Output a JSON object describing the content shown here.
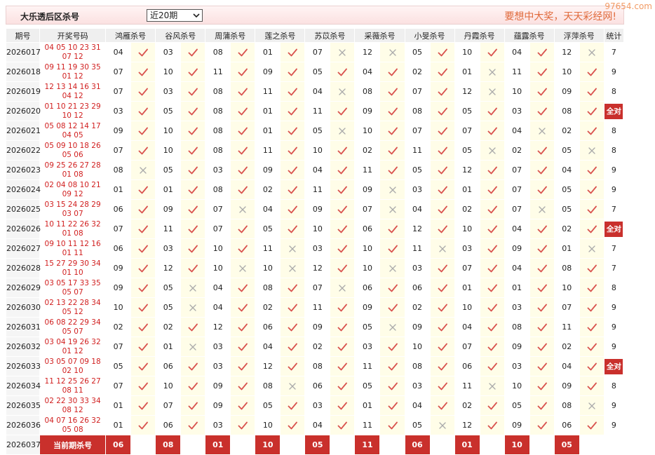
{
  "header": {
    "title": "大乐透后区杀号",
    "range_selected": "近20期",
    "slogan": "要想中大奖，天天彩经网!",
    "watermark": "97654.com"
  },
  "columns": [
    "期号",
    "开奖号码",
    "鸿雁杀号",
    "谷风杀号",
    "周蒲杀号",
    "莲之杀号",
    "苏苡杀号",
    "采薇杀号",
    "小旻杀号",
    "丹霞杀号",
    "蕴露杀号",
    "浮萍杀号",
    "统计"
  ],
  "rows": [
    {
      "period": "2026017",
      "front": "04 05 10 23 31",
      "back": "07 12",
      "kills": [
        [
          "04",
          1
        ],
        [
          "03",
          1
        ],
        [
          "08",
          1
        ],
        [
          "01",
          1
        ],
        [
          "07",
          0
        ],
        [
          "12",
          0
        ],
        [
          "05",
          1
        ],
        [
          "10",
          1
        ],
        [
          "04",
          1
        ],
        [
          "12",
          0
        ]
      ],
      "stat": "7"
    },
    {
      "period": "2026018",
      "front": "09 11 19 30 35",
      "back": "01 12",
      "kills": [
        [
          "07",
          1
        ],
        [
          "10",
          1
        ],
        [
          "11",
          1
        ],
        [
          "09",
          1
        ],
        [
          "05",
          1
        ],
        [
          "04",
          1
        ],
        [
          "02",
          1
        ],
        [
          "01",
          0
        ],
        [
          "11",
          1
        ],
        [
          "10",
          1
        ]
      ],
      "stat": "9"
    },
    {
      "period": "2026019",
      "front": "12 13 14 16 31",
      "back": "04 12",
      "kills": [
        [
          "07",
          1
        ],
        [
          "03",
          1
        ],
        [
          "08",
          1
        ],
        [
          "11",
          1
        ],
        [
          "04",
          0
        ],
        [
          "08",
          1
        ],
        [
          "07",
          1
        ],
        [
          "12",
          0
        ],
        [
          "10",
          1
        ],
        [
          "09",
          1
        ]
      ],
      "stat": "8"
    },
    {
      "period": "2026020",
      "front": "01 10 21 23 29",
      "back": "10 12",
      "kills": [
        [
          "03",
          1
        ],
        [
          "05",
          1
        ],
        [
          "08",
          1
        ],
        [
          "01",
          1
        ],
        [
          "11",
          1
        ],
        [
          "09",
          1
        ],
        [
          "08",
          1
        ],
        [
          "05",
          1
        ],
        [
          "03",
          1
        ],
        [
          "08",
          1
        ]
      ],
      "stat": "全对"
    },
    {
      "period": "2026021",
      "front": "05 08 12 14 17",
      "back": "04 05",
      "kills": [
        [
          "09",
          1
        ],
        [
          "10",
          1
        ],
        [
          "08",
          1
        ],
        [
          "01",
          1
        ],
        [
          "05",
          0
        ],
        [
          "10",
          1
        ],
        [
          "07",
          1
        ],
        [
          "07",
          1
        ],
        [
          "04",
          0
        ],
        [
          "02",
          1
        ]
      ],
      "stat": "8"
    },
    {
      "period": "2026022",
      "front": "05 09 10 18 26",
      "back": "05 06",
      "kills": [
        [
          "07",
          1
        ],
        [
          "10",
          1
        ],
        [
          "08",
          1
        ],
        [
          "11",
          1
        ],
        [
          "10",
          1
        ],
        [
          "02",
          1
        ],
        [
          "11",
          1
        ],
        [
          "05",
          0
        ],
        [
          "02",
          1
        ],
        [
          "05",
          0
        ]
      ],
      "stat": "8"
    },
    {
      "period": "2026023",
      "front": "09 25 26 27 28",
      "back": "01 08",
      "kills": [
        [
          "08",
          0
        ],
        [
          "05",
          1
        ],
        [
          "03",
          1
        ],
        [
          "09",
          1
        ],
        [
          "04",
          1
        ],
        [
          "11",
          1
        ],
        [
          "05",
          1
        ],
        [
          "12",
          1
        ],
        [
          "07",
          1
        ],
        [
          "04",
          1
        ]
      ],
      "stat": "9"
    },
    {
      "period": "2026024",
      "front": "02 04 08 10 21",
      "back": "09 12",
      "kills": [
        [
          "01",
          1
        ],
        [
          "01",
          1
        ],
        [
          "08",
          1
        ],
        [
          "02",
          1
        ],
        [
          "11",
          1
        ],
        [
          "09",
          0
        ],
        [
          "03",
          1
        ],
        [
          "01",
          1
        ],
        [
          "07",
          1
        ],
        [
          "05",
          1
        ]
      ],
      "stat": "9"
    },
    {
      "period": "2026025",
      "front": "03 15 24 28 29",
      "back": "03 07",
      "kills": [
        [
          "06",
          1
        ],
        [
          "09",
          1
        ],
        [
          "07",
          0
        ],
        [
          "04",
          1
        ],
        [
          "09",
          1
        ],
        [
          "07",
          0
        ],
        [
          "04",
          1
        ],
        [
          "02",
          1
        ],
        [
          "07",
          0
        ],
        [
          "05",
          1
        ]
      ],
      "stat": "7"
    },
    {
      "period": "2026026",
      "front": "10 11 22 26 32",
      "back": "01 08",
      "kills": [
        [
          "07",
          1
        ],
        [
          "11",
          1
        ],
        [
          "07",
          1
        ],
        [
          "05",
          1
        ],
        [
          "10",
          1
        ],
        [
          "06",
          1
        ],
        [
          "12",
          1
        ],
        [
          "10",
          1
        ],
        [
          "04",
          1
        ],
        [
          "02",
          1
        ]
      ],
      "stat": "全对"
    },
    {
      "period": "2026027",
      "front": "09 10 11 12 16",
      "back": "01 11",
      "kills": [
        [
          "06",
          1
        ],
        [
          "03",
          1
        ],
        [
          "10",
          1
        ],
        [
          "11",
          0
        ],
        [
          "03",
          1
        ],
        [
          "10",
          1
        ],
        [
          "11",
          0
        ],
        [
          "03",
          1
        ],
        [
          "09",
          1
        ],
        [
          "01",
          0
        ]
      ],
      "stat": "7"
    },
    {
      "period": "2026028",
      "front": "15 27 29 30 34",
      "back": "01 10",
      "kills": [
        [
          "09",
          1
        ],
        [
          "12",
          1
        ],
        [
          "10",
          0
        ],
        [
          "10",
          0
        ],
        [
          "12",
          1
        ],
        [
          "10",
          0
        ],
        [
          "03",
          1
        ],
        [
          "07",
          1
        ],
        [
          "04",
          1
        ],
        [
          "08",
          1
        ]
      ],
      "stat": "7"
    },
    {
      "period": "2026029",
      "front": "03 05 17 33 35",
      "back": "05 07",
      "kills": [
        [
          "09",
          1
        ],
        [
          "05",
          0
        ],
        [
          "04",
          1
        ],
        [
          "08",
          1
        ],
        [
          "07",
          0
        ],
        [
          "06",
          1
        ],
        [
          "06",
          1
        ],
        [
          "01",
          1
        ],
        [
          "01",
          1
        ],
        [
          "10",
          1
        ]
      ],
      "stat": "8"
    },
    {
      "period": "2026030",
      "front": "02 13 22 28 34",
      "back": "05 12",
      "kills": [
        [
          "10",
          1
        ],
        [
          "05",
          0
        ],
        [
          "04",
          1
        ],
        [
          "02",
          1
        ],
        [
          "11",
          1
        ],
        [
          "09",
          1
        ],
        [
          "02",
          1
        ],
        [
          "10",
          1
        ],
        [
          "03",
          1
        ],
        [
          "07",
          1
        ]
      ],
      "stat": "9"
    },
    {
      "period": "2026031",
      "front": "06 08 22 29 34",
      "back": "05 07",
      "kills": [
        [
          "02",
          1
        ],
        [
          "02",
          1
        ],
        [
          "12",
          1
        ],
        [
          "06",
          1
        ],
        [
          "09",
          1
        ],
        [
          "05",
          0
        ],
        [
          "09",
          1
        ],
        [
          "04",
          1
        ],
        [
          "08",
          1
        ],
        [
          "11",
          1
        ]
      ],
      "stat": "9"
    },
    {
      "period": "2026032",
      "front": "03 04 19 26 32",
      "back": "01 12",
      "kills": [
        [
          "07",
          1
        ],
        [
          "01",
          0
        ],
        [
          "03",
          1
        ],
        [
          "04",
          1
        ],
        [
          "02",
          1
        ],
        [
          "03",
          1
        ],
        [
          "10",
          1
        ],
        [
          "07",
          1
        ],
        [
          "09",
          1
        ],
        [
          "02",
          1
        ]
      ],
      "stat": "9"
    },
    {
      "period": "2026033",
      "front": "03 05 07 09 18",
      "back": "02 10",
      "kills": [
        [
          "05",
          1
        ],
        [
          "06",
          1
        ],
        [
          "03",
          1
        ],
        [
          "12",
          1
        ],
        [
          "08",
          1
        ],
        [
          "11",
          1
        ],
        [
          "08",
          1
        ],
        [
          "06",
          1
        ],
        [
          "03",
          1
        ],
        [
          "04",
          1
        ]
      ],
      "stat": "全对"
    },
    {
      "period": "2026034",
      "front": "11 12 25 26 27",
      "back": "08 11",
      "kills": [
        [
          "07",
          1
        ],
        [
          "10",
          1
        ],
        [
          "09",
          1
        ],
        [
          "08",
          0
        ],
        [
          "06",
          1
        ],
        [
          "05",
          1
        ],
        [
          "03",
          1
        ],
        [
          "11",
          0
        ],
        [
          "10",
          1
        ],
        [
          "09",
          1
        ]
      ],
      "stat": "8"
    },
    {
      "period": "2026035",
      "front": "02 22 30 33 34",
      "back": "08 12",
      "kills": [
        [
          "01",
          1
        ],
        [
          "07",
          1
        ],
        [
          "09",
          1
        ],
        [
          "05",
          1
        ],
        [
          "03",
          1
        ],
        [
          "01",
          1
        ],
        [
          "04",
          1
        ],
        [
          "02",
          1
        ],
        [
          "05",
          1
        ],
        [
          "08",
          0
        ]
      ],
      "stat": "9"
    },
    {
      "period": "2026036",
      "front": "04 07 16 26 32",
      "back": "05 08",
      "kills": [
        [
          "01",
          1
        ],
        [
          "06",
          1
        ],
        [
          "03",
          1
        ],
        [
          "10",
          1
        ],
        [
          "04",
          1
        ],
        [
          "11",
          1
        ],
        [
          "05",
          0
        ],
        [
          "12",
          1
        ],
        [
          "09",
          1
        ],
        [
          "06",
          1
        ]
      ],
      "stat": "9"
    }
  ],
  "current": {
    "period": "2026037",
    "label": "当前期杀号",
    "kills": [
      "06",
      "08",
      "01",
      "10",
      "05",
      "11",
      "06",
      "01",
      "10",
      "05"
    ]
  }
}
